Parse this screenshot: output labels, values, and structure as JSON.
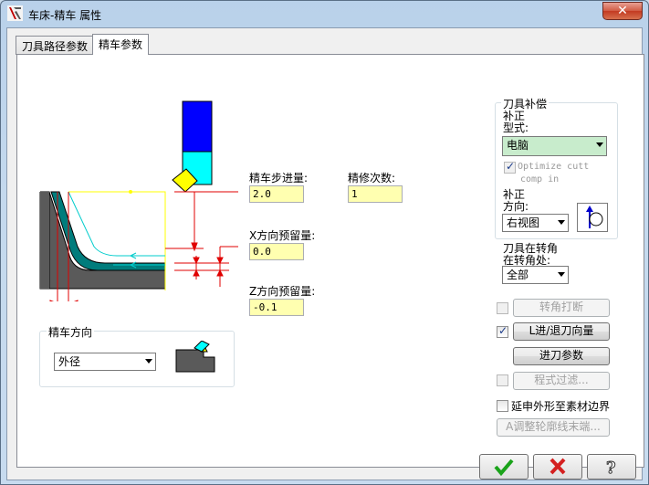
{
  "window": {
    "title": "车床-精车 属性",
    "close_label": "✕"
  },
  "tabs": [
    {
      "label": "刀具路径参数",
      "active": false
    },
    {
      "label": "精车参数",
      "active": true
    }
  ],
  "params": {
    "step_label": "精车步进量:",
    "step_value": "2.0",
    "passes_label": "精修次数:",
    "passes_value": "1",
    "x_stock_label": "X方向预留量:",
    "x_stock_value": "0.0",
    "z_stock_label": "Z方向预留量:",
    "z_stock_value": "-0.1"
  },
  "direction_group": {
    "title": "精车方向",
    "selected": "外径"
  },
  "comp_group": {
    "title": "刀具补偿",
    "type_label_1": "补正",
    "type_label_2": "型式:",
    "type_value": "电脑",
    "optimize_label_1": "Optimize cutt",
    "optimize_label_2": "comp in",
    "dir_label_1": "补正",
    "dir_label_2": "方向:",
    "dir_value": "右视图",
    "corner_label_1": "刀具在转角",
    "corner_label_2": "在转角处:",
    "corner_value": "全部"
  },
  "options": {
    "corner_break_label": "转角打断",
    "lead_label": "L进/退刀向量",
    "plunge_label": "进刀参数",
    "filter_label": "程式过滤...",
    "extend_label": "延申外形至素材边界",
    "adjust_label": "A调整轮廓线末端..."
  },
  "colors": {
    "field_bg": "#ffffb0",
    "tool_blue": "#0000ff",
    "insert_cyan": "#00ffff",
    "part_teal": "#007c7c",
    "dim_red": "#e00000"
  }
}
